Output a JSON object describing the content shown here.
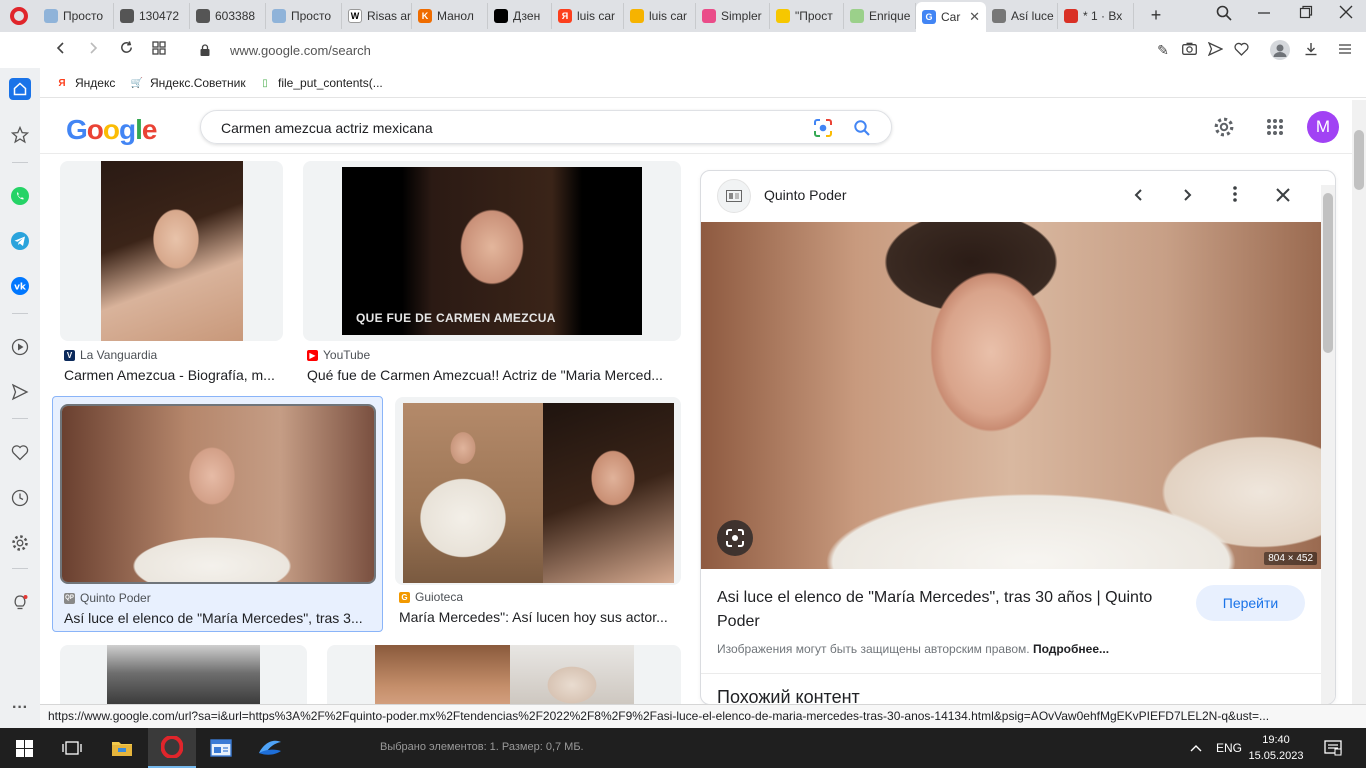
{
  "browser": {
    "tabs": [
      {
        "label": "Просто",
        "color": "#8fb3d9"
      },
      {
        "label": "130472",
        "color": "#555555"
      },
      {
        "label": "603388",
        "color": "#555555"
      },
      {
        "label": "Просто",
        "color": "#8fb3d9"
      },
      {
        "label": "Risas ar",
        "icon": "W",
        "color": "#ffffff"
      },
      {
        "label": "Манол",
        "icon": "K",
        "color": "#ef6c00"
      },
      {
        "label": "Дзен",
        "color": "#000000"
      },
      {
        "label": "luis car",
        "icon": "Я",
        "color": "#fc3f1d"
      },
      {
        "label": "luis car",
        "color": "#f6b300"
      },
      {
        "label": "Simpler",
        "color": "#ea4c89"
      },
      {
        "label": "\"Прост",
        "color": "#f6c700"
      },
      {
        "label": "Enrique",
        "color": "#9bd08a"
      },
      {
        "label": "Car",
        "icon": "G",
        "color": "#4285f4",
        "active": true
      },
      {
        "label": "Así luce",
        "color": "#777777"
      },
      {
        "label": "* 1 · Вх",
        "color": "#d93025"
      }
    ],
    "url": "www.google.com/search",
    "bookmarks": [
      {
        "label": "Яндекс",
        "icon": "Я",
        "color": "#fc3f1d"
      },
      {
        "label": "Яндекс.Советник",
        "icon": "🛒",
        "color": "#333333"
      },
      {
        "label": "file_put_contents(...",
        "icon": "▯",
        "color": "#4caf50"
      }
    ],
    "status_url": "https://www.google.com/url?sa=i&url=https%3A%2F%2Fquinto-poder.mx%2Ftendencias%2F2022%2F8%2F9%2Fasi-luce-el-elenco-de-maria-mercedes-tras-30-anos-14134.html&psig=AOvVaw0ehfMgEKvPIEFD7LEL2N-q&ust=..."
  },
  "google": {
    "logo": "Google",
    "query": "Carmen amezcua actriz mexicana",
    "avatar_letter": "M",
    "results": [
      {
        "source": "La Vanguardia",
        "source_icon": "V",
        "source_color": "#0c2a5b",
        "title": "Carmen Amezcua - Biografía, m..."
      },
      {
        "source": "YouTube",
        "source_icon": "▶",
        "source_color": "#ff0000",
        "title": "Qué fue de Carmen Amezcua!! Actriz de \"Maria Merced...",
        "overlay": "QUE FUE DE CARMEN AMEZCUA"
      },
      {
        "source": "Quinto Poder",
        "source_icon": "QP",
        "source_color": "#888888",
        "title": "Así luce el elenco de \"María Mercedes\", tras 3...",
        "selected": true
      },
      {
        "source": "Guioteca",
        "source_icon": "G",
        "source_color": "#f29900",
        "title": "María Mercedes\": Así lucen hoy sus actor..."
      }
    ],
    "preview": {
      "source": "Quinto Poder",
      "dimensions": "804 × 452",
      "title": "Asi luce el elenco de \"María Mercedes\", tras 30 años | Quinto Poder",
      "go_button": "Перейти",
      "copyright": "Изображения могут быть защищены авторским правом.",
      "more": "Подробнее...",
      "similar": "Похожий контент"
    }
  },
  "taskbar": {
    "status": "Выбрано элементов: 1. Размер: 0,7 МБ.",
    "lang": "ENG",
    "time": "19:40",
    "date": "15.05.2023"
  }
}
